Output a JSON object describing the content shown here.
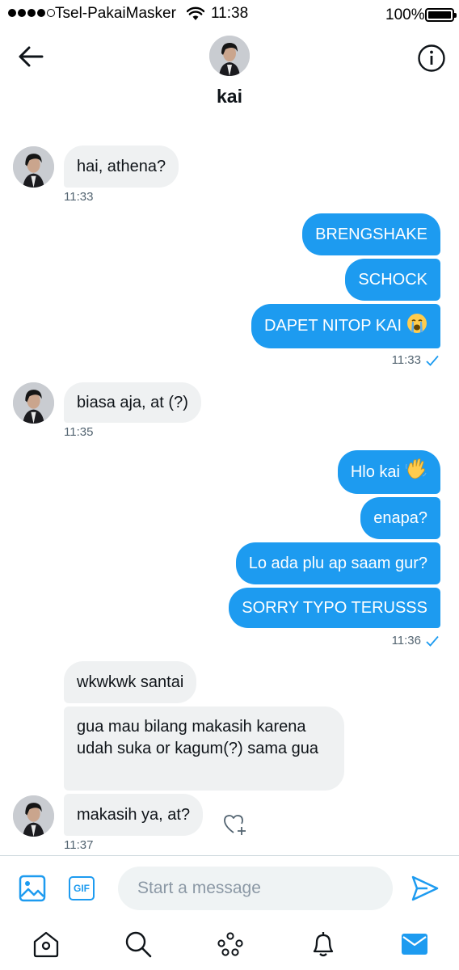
{
  "status_bar": {
    "carrier": "Tsel-PakaiMasker",
    "time": "11:38",
    "battery": "100%"
  },
  "header": {
    "contact_name": "kai"
  },
  "messages": {
    "group1": {
      "text": "hai, athena?",
      "time": "11:33"
    },
    "group2": {
      "lines": [
        "BRENGSHAKE",
        "SCHOCK",
        "DAPET NITOP KAI"
      ],
      "emoji": "crying-face",
      "time": "11:33"
    },
    "group3": {
      "text": "biasa aja, at (?)",
      "time": "11:35"
    },
    "group4": {
      "lines": [
        "Hlo kai",
        "enapa?",
        "Lo ada plu ap saam gur?",
        "SORRY TYPO TERUSSS"
      ],
      "emoji": "waving-hand",
      "time": "11:36"
    },
    "group5": {
      "lines": [
        "wkwkwk santai",
        "gua mau bilang makasih karena udah suka or kagum(?) sama gua",
        "makasih ya, at?"
      ],
      "time": "11:37"
    }
  },
  "composer": {
    "placeholder": "Start a message",
    "gif_label": "GIF"
  },
  "colors": {
    "accent": "#1d9bf0",
    "incoming_bubble": "#eff1f2",
    "timestamp": "#536471"
  },
  "icons": {
    "back": "arrow-left-icon",
    "info": "info-circle-icon",
    "image": "image-icon",
    "send": "send-icon",
    "home": "home-icon",
    "search": "search-icon",
    "spaces": "spaces-icon",
    "notifications": "bell-icon",
    "messages": "mail-icon",
    "react": "heart-plus-icon",
    "read": "checkmark-icon"
  }
}
